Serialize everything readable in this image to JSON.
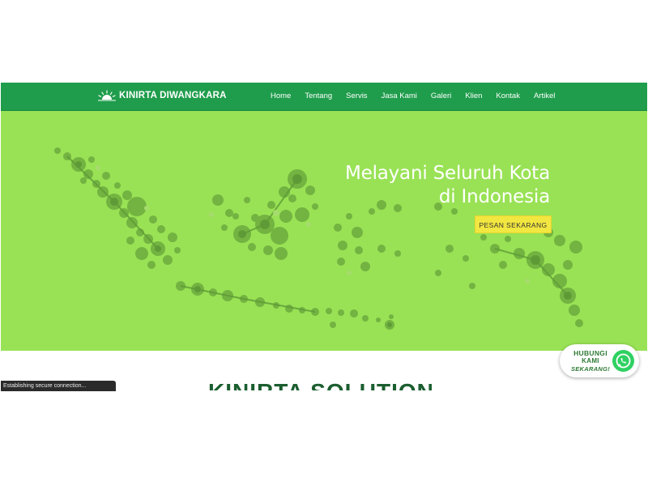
{
  "brand": {
    "name": "KINIRTA DIWANGKARA",
    "logo_icon": "sunrise-icon"
  },
  "nav": {
    "items": [
      {
        "label": "Home"
      },
      {
        "label": "Tentang"
      },
      {
        "label": "Servis"
      },
      {
        "label": "Jasa Kami"
      },
      {
        "label": "Galeri"
      },
      {
        "label": "Klien"
      },
      {
        "label": "Kontak"
      },
      {
        "label": "Artikel"
      }
    ]
  },
  "hero": {
    "headline_line1": "Melayani Seluruh Kota",
    "headline_line2": "di Indonesia",
    "cta_label": "PESAN SEKARANG",
    "background_graphic": "indonesia-dot-map"
  },
  "section": {
    "title": "KINIRTA SOLUTION"
  },
  "status_bar": {
    "text": "Establishing secure connection..."
  },
  "whatsapp": {
    "line1": "HUBUNGI",
    "line2": "KAMI",
    "line3": "SEKARANG!",
    "icon": "whatsapp-icon"
  },
  "colors": {
    "navbar": "#1f9d4c",
    "hero_bg": "#99e255",
    "cta_bg": "#f2e640",
    "title": "#1b5e2f",
    "whatsapp_green": "#2fd162"
  }
}
